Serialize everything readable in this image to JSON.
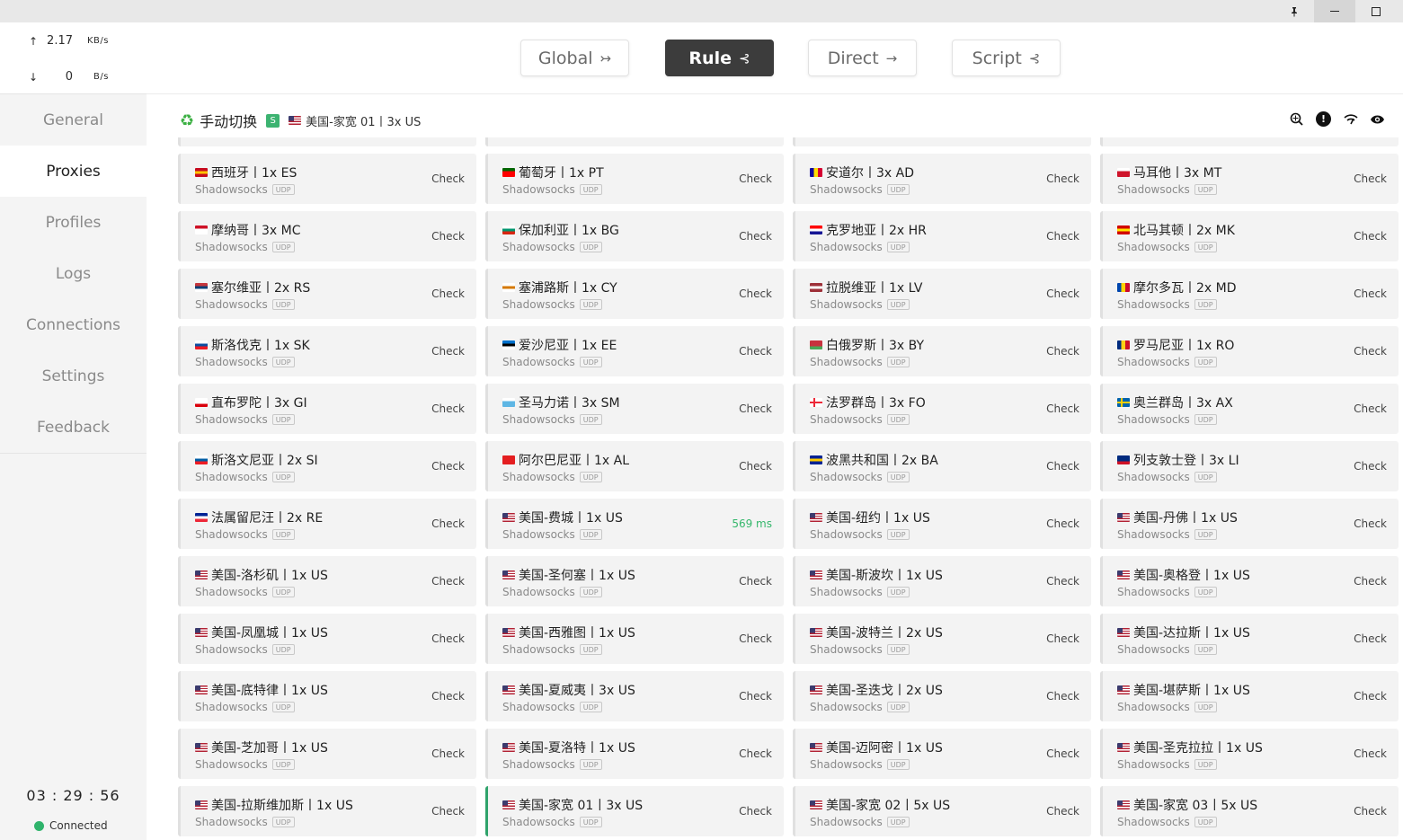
{
  "titlebar": {
    "pin_icon": "pin-icon",
    "minimize_icon": "minimize-icon",
    "maximize_icon": "maximize-icon"
  },
  "traffic": {
    "up": {
      "arrow": "↑",
      "value": "2.17",
      "unit": "KB/s"
    },
    "down": {
      "arrow": "↓",
      "value": "0",
      "unit": "B/s"
    }
  },
  "nav": {
    "items": [
      {
        "label": "General"
      },
      {
        "label": "Proxies"
      },
      {
        "label": "Profiles"
      },
      {
        "label": "Logs"
      },
      {
        "label": "Connections"
      },
      {
        "label": "Settings"
      },
      {
        "label": "Feedback"
      }
    ],
    "active_index": 1
  },
  "footer": {
    "clock": "03 : 29 : 56",
    "status": "Connected",
    "status_color": "#2fb36b"
  },
  "modes": [
    {
      "label": "Global",
      "icon": "↣",
      "active": false
    },
    {
      "label": "Rule",
      "icon": "⊰",
      "active": true
    },
    {
      "label": "Direct",
      "icon": "→",
      "active": false
    },
    {
      "label": "Script",
      "icon": "⊰",
      "active": false
    }
  ],
  "group": {
    "icon": "recycle-icon",
    "name": "手动切换",
    "badge": "S",
    "current_flag": "us",
    "current": "美国-家宽 01丨3x US"
  },
  "header_icons": [
    "network-search-icon",
    "alert-icon",
    "wifi-speed-icon",
    "eye-icon"
  ],
  "proxies": [
    {
      "name": "西班牙丨1x ES",
      "flag": "es",
      "type": "Shadowsocks",
      "udp": "UDP",
      "check": "Check"
    },
    {
      "name": "葡萄牙丨1x PT",
      "flag": "pt",
      "type": "Shadowsocks",
      "udp": "UDP",
      "check": "Check"
    },
    {
      "name": "安道尔丨3x AD",
      "flag": "ad",
      "type": "Shadowsocks",
      "udp": "UDP",
      "check": "Check"
    },
    {
      "name": "马耳他丨3x MT",
      "flag": "mt",
      "type": "Shadowsocks",
      "udp": "UDP",
      "check": "Check"
    },
    {
      "name": "摩纳哥丨3x MC",
      "flag": "mc",
      "type": "Shadowsocks",
      "udp": "UDP",
      "check": "Check"
    },
    {
      "name": "保加利亚丨1x BG",
      "flag": "bg",
      "type": "Shadowsocks",
      "udp": "UDP",
      "check": "Check"
    },
    {
      "name": "克罗地亚丨2x HR",
      "flag": "hr",
      "type": "Shadowsocks",
      "udp": "UDP",
      "check": "Check"
    },
    {
      "name": "北马其顿丨2x MK",
      "flag": "mk",
      "type": "Shadowsocks",
      "udp": "UDP",
      "check": "Check"
    },
    {
      "name": "塞尔维亚丨2x RS",
      "flag": "rs",
      "type": "Shadowsocks",
      "udp": "UDP",
      "check": "Check"
    },
    {
      "name": "塞浦路斯丨1x CY",
      "flag": "cy",
      "type": "Shadowsocks",
      "udp": "UDP",
      "check": "Check"
    },
    {
      "name": "拉脱维亚丨1x LV",
      "flag": "lv",
      "type": "Shadowsocks",
      "udp": "UDP",
      "check": "Check"
    },
    {
      "name": "摩尔多瓦丨2x MD",
      "flag": "md",
      "type": "Shadowsocks",
      "udp": "UDP",
      "check": "Check"
    },
    {
      "name": "斯洛伐克丨1x SK",
      "flag": "sk",
      "type": "Shadowsocks",
      "udp": "UDP",
      "check": "Check"
    },
    {
      "name": "爱沙尼亚丨1x EE",
      "flag": "ee",
      "type": "Shadowsocks",
      "udp": "UDP",
      "check": "Check"
    },
    {
      "name": "白俄罗斯丨3x BY",
      "flag": "by",
      "type": "Shadowsocks",
      "udp": "UDP",
      "check": "Check"
    },
    {
      "name": "罗马尼亚丨1x RO",
      "flag": "ro",
      "type": "Shadowsocks",
      "udp": "UDP",
      "check": "Check"
    },
    {
      "name": "直布罗陀丨3x GI",
      "flag": "gi",
      "type": "Shadowsocks",
      "udp": "UDP",
      "check": "Check"
    },
    {
      "name": "圣马力诺丨3x SM",
      "flag": "sm",
      "type": "Shadowsocks",
      "udp": "UDP",
      "check": "Check"
    },
    {
      "name": "法罗群岛丨3x FO",
      "flag": "fo",
      "type": "Shadowsocks",
      "udp": "UDP",
      "check": "Check"
    },
    {
      "name": "奥兰群岛丨3x AX",
      "flag": "ax",
      "type": "Shadowsocks",
      "udp": "UDP",
      "check": "Check"
    },
    {
      "name": "斯洛文尼亚丨2x SI",
      "flag": "si",
      "type": "Shadowsocks",
      "udp": "UDP",
      "check": "Check"
    },
    {
      "name": "阿尔巴尼亚丨1x AL",
      "flag": "al",
      "type": "Shadowsocks",
      "udp": "UDP",
      "check": "Check"
    },
    {
      "name": "波黑共和国丨2x BA",
      "flag": "ba",
      "type": "Shadowsocks",
      "udp": "UDP",
      "check": "Check"
    },
    {
      "name": "列支敦士登丨3x LI",
      "flag": "li",
      "type": "Shadowsocks",
      "udp": "UDP",
      "check": "Check"
    },
    {
      "name": "法属留尼汪丨2x RE",
      "flag": "re",
      "type": "Shadowsocks",
      "udp": "UDP",
      "check": "Check"
    },
    {
      "name": "美国-费城丨1x US",
      "flag": "us",
      "type": "Shadowsocks",
      "udp": "UDP",
      "check": "569 ms",
      "ok": true
    },
    {
      "name": "美国-纽约丨1x US",
      "flag": "us",
      "type": "Shadowsocks",
      "udp": "UDP",
      "check": "Check"
    },
    {
      "name": "美国-丹佛丨1x US",
      "flag": "us",
      "type": "Shadowsocks",
      "udp": "UDP",
      "check": "Check"
    },
    {
      "name": "美国-洛杉矶丨1x US",
      "flag": "us",
      "type": "Shadowsocks",
      "udp": "UDP",
      "check": "Check"
    },
    {
      "name": "美国-圣何塞丨1x US",
      "flag": "us",
      "type": "Shadowsocks",
      "udp": "UDP",
      "check": "Check"
    },
    {
      "name": "美国-斯波坎丨1x US",
      "flag": "us",
      "type": "Shadowsocks",
      "udp": "UDP",
      "check": "Check"
    },
    {
      "name": "美国-奥格登丨1x US",
      "flag": "us",
      "type": "Shadowsocks",
      "udp": "UDP",
      "check": "Check"
    },
    {
      "name": "美国-凤凰城丨1x US",
      "flag": "us",
      "type": "Shadowsocks",
      "udp": "UDP",
      "check": "Check"
    },
    {
      "name": "美国-西雅图丨1x US",
      "flag": "us",
      "type": "Shadowsocks",
      "udp": "UDP",
      "check": "Check"
    },
    {
      "name": "美国-波特兰丨2x US",
      "flag": "us",
      "type": "Shadowsocks",
      "udp": "UDP",
      "check": "Check"
    },
    {
      "name": "美国-达拉斯丨1x US",
      "flag": "us",
      "type": "Shadowsocks",
      "udp": "UDP",
      "check": "Check"
    },
    {
      "name": "美国-底特律丨1x US",
      "flag": "us",
      "type": "Shadowsocks",
      "udp": "UDP",
      "check": "Check"
    },
    {
      "name": "美国-夏威夷丨3x US",
      "flag": "us",
      "type": "Shadowsocks",
      "udp": "UDP",
      "check": "Check"
    },
    {
      "name": "美国-圣迭戈丨2x US",
      "flag": "us",
      "type": "Shadowsocks",
      "udp": "UDP",
      "check": "Check"
    },
    {
      "name": "美国-堪萨斯丨1x US",
      "flag": "us",
      "type": "Shadowsocks",
      "udp": "UDP",
      "check": "Check"
    },
    {
      "name": "美国-芝加哥丨1x US",
      "flag": "us",
      "type": "Shadowsocks",
      "udp": "UDP",
      "check": "Check"
    },
    {
      "name": "美国-夏洛特丨1x US",
      "flag": "us",
      "type": "Shadowsocks",
      "udp": "UDP",
      "check": "Check"
    },
    {
      "name": "美国-迈阿密丨1x US",
      "flag": "us",
      "type": "Shadowsocks",
      "udp": "UDP",
      "check": "Check"
    },
    {
      "name": "美国-圣克拉拉丨1x US",
      "flag": "us",
      "type": "Shadowsocks",
      "udp": "UDP",
      "check": "Check"
    },
    {
      "name": "美国-拉斯维加斯丨1x US",
      "flag": "us",
      "type": "Shadowsocks",
      "udp": "UDP",
      "check": "Check"
    },
    {
      "name": "美国-家宽 01丨3x US",
      "flag": "us",
      "type": "Shadowsocks",
      "udp": "UDP",
      "check": "Check",
      "selected": true
    },
    {
      "name": "美国-家宽 02丨5x US",
      "flag": "us",
      "type": "Shadowsocks",
      "udp": "UDP",
      "check": "Check"
    },
    {
      "name": "美国-家宽 03丨5x US",
      "flag": "us",
      "type": "Shadowsocks",
      "udp": "UDP",
      "check": "Check"
    }
  ],
  "flag_colors": {
    "es": [
      "#c60b1e",
      "#ffc400",
      "#c60b1e"
    ],
    "pt": [
      "#006600",
      "#ff0000",
      "#ff0000"
    ],
    "ad": [
      "#10069f",
      "#fedd00",
      "#d50032"
    ],
    "mt": [
      "#ffffff",
      "#cf142b",
      "#cf142b"
    ],
    "mc": [
      "#ce1126",
      "#ffffff",
      "#ffffff"
    ],
    "bg": [
      "#ffffff",
      "#00966e",
      "#d62612"
    ],
    "hr": [
      "#ff0000",
      "#ffffff",
      "#171796"
    ],
    "mk": [
      "#d20000",
      "#ffe600",
      "#d20000"
    ],
    "rs": [
      "#c6363c",
      "#0c4076",
      "#ffffff"
    ],
    "cy": [
      "#ffffff",
      "#d57800",
      "#ffffff"
    ],
    "lv": [
      "#9e3039",
      "#ffffff",
      "#9e3039"
    ],
    "md": [
      "#0046ae",
      "#ffd200",
      "#cc092f"
    ],
    "sk": [
      "#ffffff",
      "#0b4ea2",
      "#ee1c25"
    ],
    "ee": [
      "#0072ce",
      "#000000",
      "#ffffff"
    ],
    "by": [
      "#c8313e",
      "#c8313e",
      "#4aa657"
    ],
    "ro": [
      "#002b7f",
      "#fcd116",
      "#ce1126"
    ],
    "gi": [
      "#ffffff",
      "#ffffff",
      "#da000c"
    ],
    "sm": [
      "#ffffff",
      "#5eb6e4",
      "#5eb6e4"
    ],
    "fo": [
      "#ffffff",
      "#ed2939",
      "#ffffff"
    ],
    "ax": [
      "#0064ad",
      "#ffce00",
      "#0064ad"
    ],
    "si": [
      "#ffffff",
      "#005da4",
      "#ed1c24"
    ],
    "al": [
      "#e41e20",
      "#e41e20",
      "#e41e20"
    ],
    "ba": [
      "#002395",
      "#fecb00",
      "#002395"
    ],
    "li": [
      "#002b7f",
      "#002b7f",
      "#ce1126"
    ],
    "re": [
      "#002395",
      "#ffffff",
      "#ed2939"
    ],
    "us": [
      "#b22234",
      "#ffffff",
      "#3c3b6e"
    ]
  }
}
